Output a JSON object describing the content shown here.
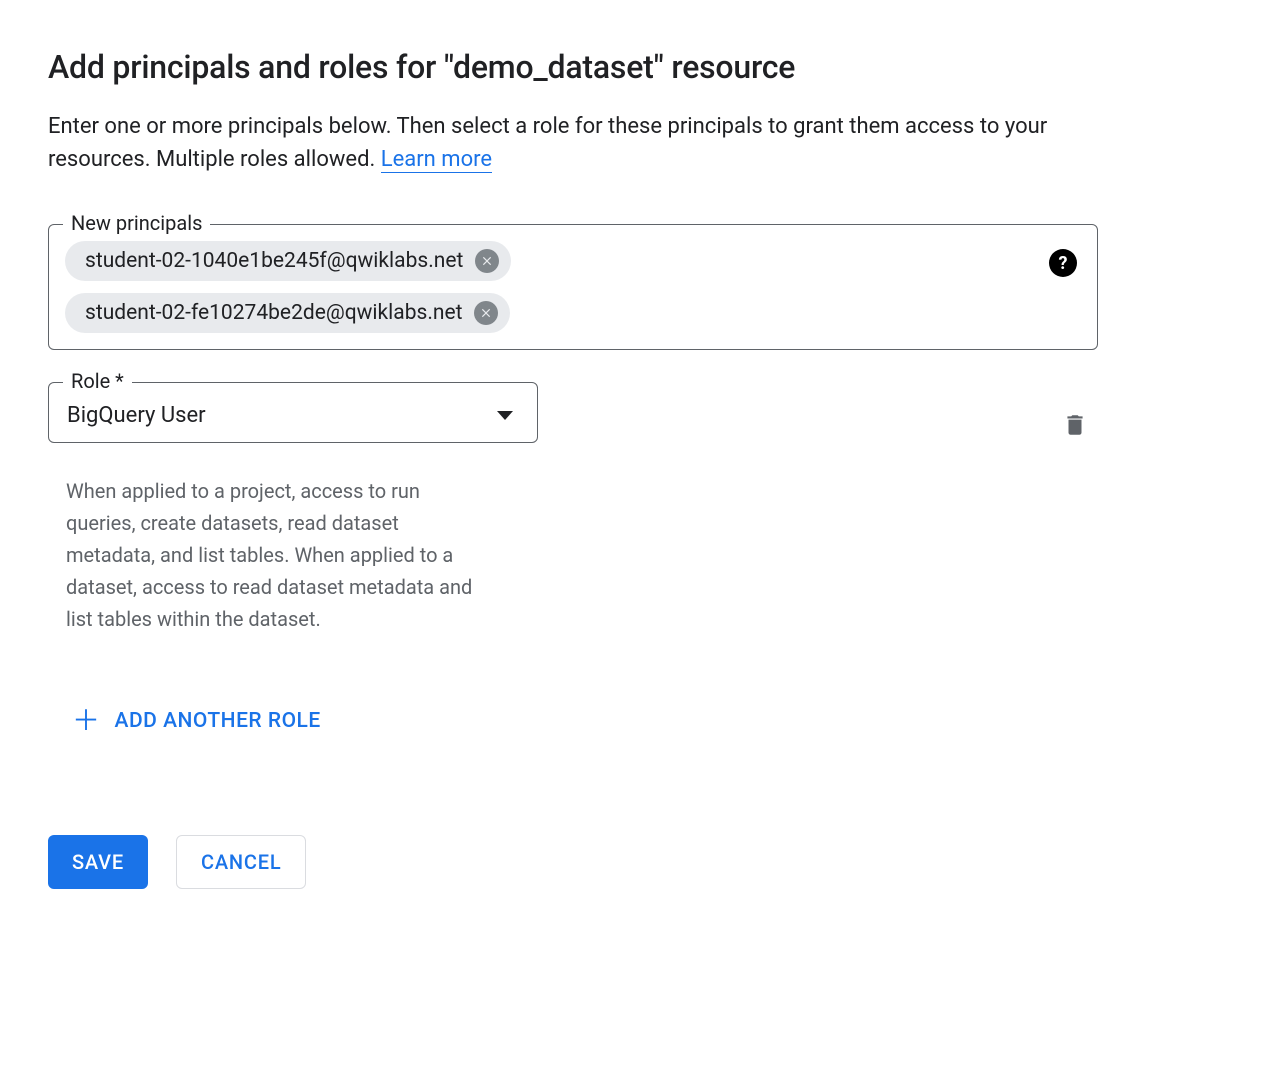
{
  "header": {
    "title": "Add principals and roles for \"demo_dataset\" resource",
    "description_prefix": "Enter one or more principals below. Then select a role for these principals to grant them access to your resources. Multiple roles allowed. ",
    "learn_more": "Learn more"
  },
  "principals": {
    "legend": "New principals",
    "chips": [
      "student-02-1040e1be245f@qwiklabs.net",
      "student-02-fe10274be2de@qwiklabs.net"
    ]
  },
  "role": {
    "legend": "Role *",
    "selected": "BigQuery User",
    "description": "When applied to a project, access to run queries, create datasets, read dataset metadata, and list tables. When applied to a dataset, access to read dataset metadata and list tables within the dataset."
  },
  "actions": {
    "add_another_role": "ADD ANOTHER ROLE",
    "save": "SAVE",
    "cancel": "CANCEL"
  }
}
